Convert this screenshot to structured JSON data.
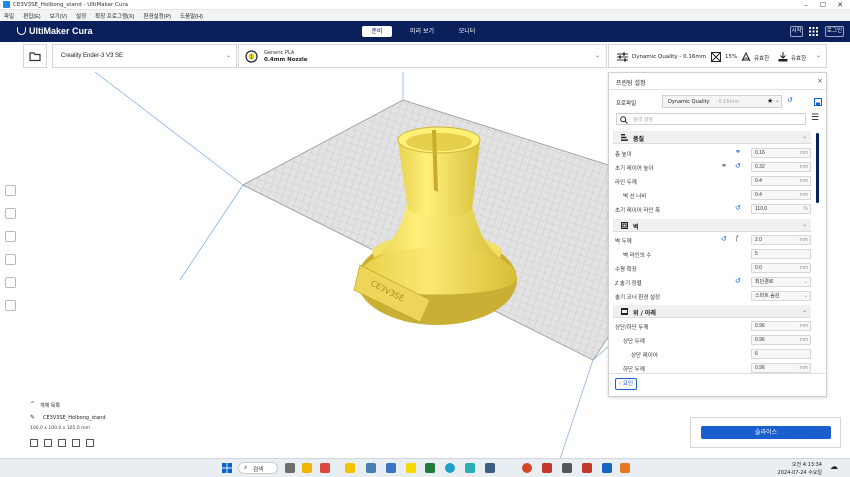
{
  "window": {
    "title": "CE3V3SE_Holbong_stand - UltiMaker Cura"
  },
  "menu": [
    "파일",
    "편집(E)",
    "보기(V)",
    "설정",
    "확장 프로그램(X)",
    "환경설정(P)",
    "도움말(H)"
  ],
  "header": {
    "logo": "UltiMaker Cura",
    "stages": [
      "준비",
      "미리 보기",
      "모니터"
    ],
    "active_stage": "준비",
    "sign_in": "시작",
    "marketplace": "로그인"
  },
  "printer": {
    "name": "Creality Ender-3 V3 SE"
  },
  "material": {
    "name": "Generic PLA",
    "nozzle": "0.4mm Nozzle"
  },
  "print_setup_summary": {
    "profile": "Dynamic Quality - 0.16mm",
    "infill": "15%",
    "support": "유효한",
    "adhesion": "유효한"
  },
  "panel": {
    "title": "프린팅 설정",
    "profile_label": "프로파일",
    "profile_value": "Dynamic Quality",
    "profile_suffix": "- 0.16mm",
    "search_placeholder": "검색 설정",
    "categories": [
      {
        "name": "품질"
      },
      {
        "name": "벽"
      },
      {
        "name": "위 / 아래"
      }
    ],
    "quality_rows": [
      {
        "label": "층 높이",
        "value": "0.16",
        "unit": "mm"
      },
      {
        "label": "초기 레이어 높이",
        "value": "0.32",
        "unit": "mm"
      },
      {
        "label": "라인 두께",
        "value": "0.4",
        "unit": "mm"
      },
      {
        "label": "벽 선 너비",
        "value": "0.4",
        "unit": "mm"
      },
      {
        "label": "초기 레이어 라인 폭",
        "value": "110.0",
        "unit": "%"
      }
    ],
    "wall_rows": [
      {
        "label": "벽 두께",
        "value": "2.0",
        "unit": "mm"
      },
      {
        "label": "벽 라인의 수",
        "value": "5",
        "unit": ""
      },
      {
        "label": "수평 확장",
        "value": "0.0",
        "unit": "mm"
      },
      {
        "label": "Z 솔기 정렬",
        "value": "최단경로",
        "unit": ""
      },
      {
        "label": "솔기 코너 환경 설정",
        "value": "스마트 숨김",
        "unit": ""
      }
    ],
    "topbottom_rows": [
      {
        "label": "상단/하단 두께",
        "value": "0.96",
        "unit": "mm"
      },
      {
        "label": "상단 두께",
        "value": "0.96",
        "unit": "mm"
      },
      {
        "label": "상단 레이어",
        "value": "6",
        "unit": ""
      },
      {
        "label": "하단 두께",
        "value": "0.96",
        "unit": "mm"
      }
    ],
    "back_button": "요인"
  },
  "object_list": {
    "header": "개체 목록",
    "object_name": "CE3V3SE_Holbong_stand",
    "dimensions": "100.0 x 100.0 x 105.0 mm"
  },
  "slice_button": "슬라이스",
  "taskbar": {
    "search": "검색",
    "time": "오전 4:13:34",
    "date": "2024-07-24 수요일"
  },
  "colors": {
    "header_bg": "#0b1f5b",
    "accent": "#1a5fd0",
    "model": "#f7e86a",
    "grid": "#bdbdbd"
  }
}
